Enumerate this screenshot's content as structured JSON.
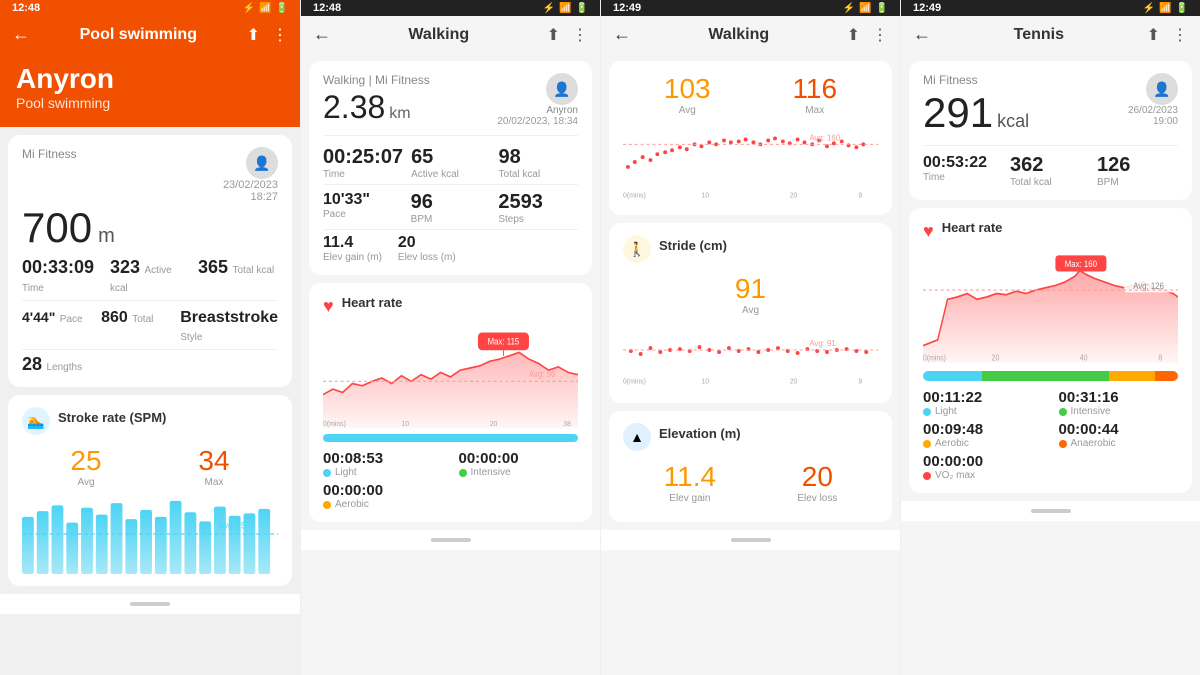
{
  "panel1": {
    "status_time": "12:48",
    "title": "Pool swimming",
    "user_name": "Anyron",
    "activity": "Pool swimming",
    "provider": "Mi Fitness",
    "main_value": "700",
    "main_unit": "m",
    "date": "23/02/2023",
    "time_str": "18:27",
    "stats": {
      "time": "00:33:09",
      "time_label": "Time",
      "active_kcal": "323",
      "active_kcal_label": "Active kcal",
      "total_kcal": "365",
      "total_kcal_label": "Total kcal",
      "pace": "4'44\"",
      "pace_label": "Pace",
      "total": "860",
      "total_label": "Total",
      "style": "Breaststroke",
      "style_label": "Style",
      "lengths": "28",
      "lengths_label": "Lengths"
    },
    "stroke_rate": {
      "title": "Stroke rate (SPM)",
      "avg": "25",
      "avg_label": "Avg",
      "max": "34",
      "max_label": "Max"
    }
  },
  "panel2": {
    "status_time": "12:48",
    "title": "Walking",
    "provider": "Walking | Mi Fitness",
    "main_value": "2.38",
    "main_unit": "km",
    "user": "Anyron",
    "date": "20/02/2023, 18:34",
    "stats1": {
      "time": "00:25:07",
      "time_label": "Time",
      "active_kcal": "65",
      "active_kcal_label": "Active kcal",
      "total_kcal": "98",
      "total_kcal_label": "Total kcal"
    },
    "stats2": {
      "pace": "10'33\"",
      "pace_label": "Pace",
      "bpm": "96",
      "bpm_label": "BPM",
      "steps": "2593",
      "steps_label": "Steps"
    },
    "stats3": {
      "elev_gain": "11.4",
      "elev_gain_label": "Elev gain (m)",
      "elev_loss": "20",
      "elev_loss_label": "Elev loss (m)"
    },
    "heart_rate": {
      "title": "Heart rate",
      "max_label": "Max: 115",
      "avg_label": "Avg: 96"
    },
    "zones": {
      "light_time": "00:08:53",
      "light_label": "Light",
      "intensive_time": "00:00:00",
      "intensive_label": "Intensive",
      "aerobic_time": "00:00:00",
      "aerobic_label": "Aerobic"
    }
  },
  "panel3": {
    "status_time": "12:49",
    "title": "Walking",
    "avg_value": "103",
    "avg_label": "Avg",
    "max_value": "116",
    "max_label": "Max",
    "stride": {
      "title": "Stride (cm)",
      "avg": "91",
      "avg_label": "Avg"
    },
    "elevation": {
      "title": "Elevation (m)",
      "elev_gain": "11.4",
      "elev_gain_label": "Elev gain",
      "elev_loss": "20",
      "elev_loss_label": "Elev loss"
    }
  },
  "panel4": {
    "status_time": "12:49",
    "title": "Tennis",
    "provider": "Mi Fitness",
    "main_value": "291",
    "main_unit": "kcal",
    "date": "26/02/2023",
    "time_str": "19:00",
    "stats": {
      "time": "00:53:22",
      "time_label": "Time",
      "total_kcal": "362",
      "total_kcal_label": "Total kcal",
      "bpm": "126",
      "bpm_label": "BPM"
    },
    "heart_rate": {
      "title": "Heart rate",
      "max_label": "Max: 160",
      "avg_label": "Avg: 126"
    },
    "zones": {
      "light_time": "00:11:22",
      "light_label": "Light",
      "intensive_time": "00:31:16",
      "intensive_label": "Intensive",
      "aerobic_time": "00:09:48",
      "aerobic_label": "Aerobic",
      "anaerobic_time": "00:00:44",
      "anaerobic_label": "Anaerobic",
      "vo2_time": "00:00:00",
      "vo2_label": "VO₂ max"
    }
  },
  "icons": {
    "back": "←",
    "share": "⬆",
    "more": "⋮",
    "heart": "♥",
    "stride": "👣",
    "elevation": "▲"
  }
}
